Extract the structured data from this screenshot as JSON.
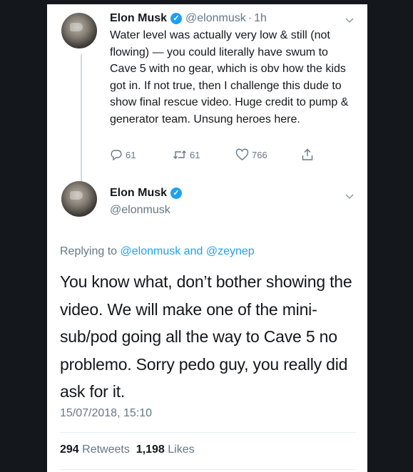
{
  "tweet1": {
    "author_name": "Elon Musk",
    "handle": "@elonmusk",
    "separator": "·",
    "time": "1h",
    "text": "Water level was actually very low & still (not flowing) — you could literally have swum to Cave 5 with no gear, which is obv how the kids got in. If not true, then I challenge this dude to show final rescue video. Huge credit to pump & generator team. Unsung heroes here.",
    "replies": "61",
    "retweets": "61",
    "likes": "766",
    "icons": [
      "reply-icon",
      "retweet-icon",
      "like-icon",
      "share-icon",
      "chevron-down-icon",
      "verified-badge-icon"
    ]
  },
  "tweet2": {
    "author_name": "Elon Musk",
    "handle": "@elonmusk",
    "replying_prefix": "Replying to",
    "replying_user1": "@elonmusk",
    "replying_and": "and",
    "replying_user2": "@zeynep",
    "text": "You know what, don’t bother showing the video. We will make one of the mini-sub/pod going all the way to Cave 5 no problemo. Sorry pedo guy, you really did ask for it.",
    "timestamp": "15/07/2018, 15:10",
    "retweet_count": "294",
    "retweet_label": "Retweets",
    "like_count": "1,198",
    "like_label": "Likes"
  },
  "colors": {
    "background": "#14171c",
    "card": "#ffffff",
    "accent": "#1da1f2",
    "text": "#14171a",
    "secondary": "#657786"
  }
}
